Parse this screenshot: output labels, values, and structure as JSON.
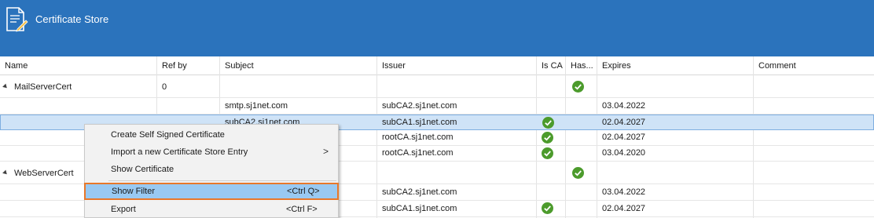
{
  "app": {
    "title": "Certificate Store",
    "icon": "document-pen-icon"
  },
  "columns": [
    "Name",
    "Ref by",
    "Subject",
    "Issuer",
    "Is CA",
    "Has...",
    "Expires",
    "Comment"
  ],
  "groups": [
    {
      "name": "MailServerCert",
      "ref_by": "0",
      "has_key": true
    },
    {
      "name": "WebServerCert",
      "ref_by": "",
      "has_key": true
    }
  ],
  "rows": [
    {
      "subject": "smtp.sj1net.com",
      "issuer": "subCA2.sj1net.com",
      "is_ca": false,
      "expires": "03.04.2022"
    },
    {
      "subject": "subCA2.sj1net.com",
      "issuer": "subCA1.sj1net.com",
      "is_ca": true,
      "expires": "02.04.2027"
    },
    {
      "subject": "",
      "issuer": "rootCA.sj1net.com",
      "is_ca": true,
      "expires": "02.04.2027"
    },
    {
      "subject": "",
      "issuer": "rootCA.sj1net.com",
      "is_ca": true,
      "expires": "03.04.2020"
    },
    {
      "subject": "",
      "issuer": "subCA2.sj1net.com",
      "is_ca": false,
      "expires": "03.04.2022"
    },
    {
      "subject": "",
      "issuer": "subCA1.sj1net.com",
      "is_ca": true,
      "expires": "02.04.2027"
    }
  ],
  "context_menu": {
    "items": [
      {
        "label": "Create Self Signed Certificate",
        "shortcut": ""
      },
      {
        "label": "Import a new Certificate Store Entry",
        "shortcut": "",
        "submenu_arrow": ">"
      },
      {
        "label": "Show Certificate",
        "shortcut": ""
      },
      {
        "label": "Show Filter",
        "shortcut": "<Ctrl Q>",
        "highlighted": true
      },
      {
        "label": "Export",
        "shortcut": "<Ctrl F>"
      }
    ]
  },
  "colors": {
    "header": "#2b73bc",
    "selection": "#cfe3f7",
    "check": "#4c9b2c",
    "menu_highlight": "#99c9f2",
    "highlight_border": "#e8782a"
  }
}
